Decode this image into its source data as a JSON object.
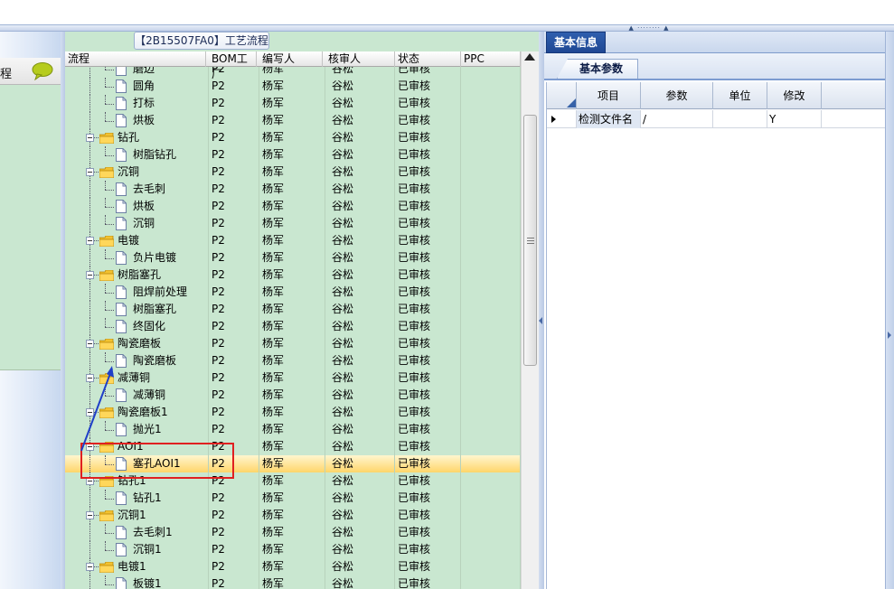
{
  "panel_title": "【2B15507FA0】工艺流程",
  "left_panel": {
    "header_text": "程"
  },
  "columns": [
    "流程",
    "BOM工厂",
    "编写人",
    "核审人",
    "状态",
    "PPC"
  ],
  "rows": [
    {
      "level": 2,
      "type": "file",
      "name": "磨边",
      "bom": "P2",
      "writer": "杨军",
      "reviewer": "谷松",
      "status": "已审核",
      "ppc": ""
    },
    {
      "level": 2,
      "type": "file",
      "name": "圆角",
      "bom": "P2",
      "writer": "杨军",
      "reviewer": "谷松",
      "status": "已审核",
      "ppc": ""
    },
    {
      "level": 2,
      "type": "file",
      "name": "打标",
      "bom": "P2",
      "writer": "杨军",
      "reviewer": "谷松",
      "status": "已审核",
      "ppc": ""
    },
    {
      "level": 2,
      "type": "file",
      "name": "烘板",
      "bom": "P2",
      "writer": "杨军",
      "reviewer": "谷松",
      "status": "已审核",
      "ppc": ""
    },
    {
      "level": 1,
      "type": "folder",
      "name": "钻孔",
      "bom": "P2",
      "writer": "杨军",
      "reviewer": "谷松",
      "status": "已审核",
      "ppc": ""
    },
    {
      "level": 2,
      "type": "file",
      "name": "树脂钻孔",
      "bom": "P2",
      "writer": "杨军",
      "reviewer": "谷松",
      "status": "已审核",
      "ppc": ""
    },
    {
      "level": 1,
      "type": "folder",
      "name": "沉铜",
      "bom": "P2",
      "writer": "杨军",
      "reviewer": "谷松",
      "status": "已审核",
      "ppc": ""
    },
    {
      "level": 2,
      "type": "file",
      "name": "去毛刺",
      "bom": "P2",
      "writer": "杨军",
      "reviewer": "谷松",
      "status": "已审核",
      "ppc": ""
    },
    {
      "level": 2,
      "type": "file",
      "name": "烘板",
      "bom": "P2",
      "writer": "杨军",
      "reviewer": "谷松",
      "status": "已审核",
      "ppc": ""
    },
    {
      "level": 2,
      "type": "file",
      "name": "沉铜",
      "bom": "P2",
      "writer": "杨军",
      "reviewer": "谷松",
      "status": "已审核",
      "ppc": ""
    },
    {
      "level": 1,
      "type": "folder",
      "name": "电镀",
      "bom": "P2",
      "writer": "杨军",
      "reviewer": "谷松",
      "status": "已审核",
      "ppc": ""
    },
    {
      "level": 2,
      "type": "file",
      "name": "负片电镀",
      "bom": "P2",
      "writer": "杨军",
      "reviewer": "谷松",
      "status": "已审核",
      "ppc": ""
    },
    {
      "level": 1,
      "type": "folder",
      "name": "树脂塞孔",
      "bom": "P2",
      "writer": "杨军",
      "reviewer": "谷松",
      "status": "已审核",
      "ppc": ""
    },
    {
      "level": 2,
      "type": "file",
      "name": "阻焊前处理",
      "bom": "P2",
      "writer": "杨军",
      "reviewer": "谷松",
      "status": "已审核",
      "ppc": ""
    },
    {
      "level": 2,
      "type": "file",
      "name": "树脂塞孔",
      "bom": "P2",
      "writer": "杨军",
      "reviewer": "谷松",
      "status": "已审核",
      "ppc": ""
    },
    {
      "level": 2,
      "type": "file",
      "name": "终固化",
      "bom": "P2",
      "writer": "杨军",
      "reviewer": "谷松",
      "status": "已审核",
      "ppc": ""
    },
    {
      "level": 1,
      "type": "folder",
      "name": "陶瓷磨板",
      "bom": "P2",
      "writer": "杨军",
      "reviewer": "谷松",
      "status": "已审核",
      "ppc": ""
    },
    {
      "level": 2,
      "type": "file",
      "name": "陶瓷磨板",
      "bom": "P2",
      "writer": "杨军",
      "reviewer": "谷松",
      "status": "已审核",
      "ppc": ""
    },
    {
      "level": 1,
      "type": "folder",
      "name": "减薄铜",
      "bom": "P2",
      "writer": "杨军",
      "reviewer": "谷松",
      "status": "已审核",
      "ppc": ""
    },
    {
      "level": 2,
      "type": "file",
      "name": "减薄铜",
      "bom": "P2",
      "writer": "杨军",
      "reviewer": "谷松",
      "status": "已审核",
      "ppc": ""
    },
    {
      "level": 1,
      "type": "folder",
      "name": "陶瓷磨板1",
      "bom": "P2",
      "writer": "杨军",
      "reviewer": "谷松",
      "status": "已审核",
      "ppc": ""
    },
    {
      "level": 2,
      "type": "file",
      "name": "抛光1",
      "bom": "P2",
      "writer": "杨军",
      "reviewer": "谷松",
      "status": "已审核",
      "ppc": ""
    },
    {
      "level": 1,
      "type": "folder",
      "name": "AOI1",
      "bom": "P2",
      "writer": "杨军",
      "reviewer": "谷松",
      "status": "已审核",
      "ppc": ""
    },
    {
      "level": 2,
      "type": "file",
      "name": "塞孔AOI1",
      "bom": "P2",
      "writer": "杨军",
      "reviewer": "谷松",
      "status": "已审核",
      "ppc": "",
      "selected": true
    },
    {
      "level": 1,
      "type": "folder",
      "name": "钻孔1",
      "bom": "P2",
      "writer": "杨军",
      "reviewer": "谷松",
      "status": "已审核",
      "ppc": ""
    },
    {
      "level": 2,
      "type": "file",
      "name": "钻孔1",
      "bom": "P2",
      "writer": "杨军",
      "reviewer": "谷松",
      "status": "已审核",
      "ppc": ""
    },
    {
      "level": 1,
      "type": "folder",
      "name": "沉铜1",
      "bom": "P2",
      "writer": "杨军",
      "reviewer": "谷松",
      "status": "已审核",
      "ppc": ""
    },
    {
      "level": 2,
      "type": "file",
      "name": "去毛刺1",
      "bom": "P2",
      "writer": "杨军",
      "reviewer": "谷松",
      "status": "已审核",
      "ppc": ""
    },
    {
      "level": 2,
      "type": "file",
      "name": "沉铜1",
      "bom": "P2",
      "writer": "杨军",
      "reviewer": "谷松",
      "status": "已审核",
      "ppc": ""
    },
    {
      "level": 1,
      "type": "folder",
      "name": "电镀1",
      "bom": "P2",
      "writer": "杨军",
      "reviewer": "谷松",
      "status": "已审核",
      "ppc": ""
    },
    {
      "level": 2,
      "type": "file",
      "name": "板镀1",
      "bom": "P2",
      "writer": "杨军",
      "reviewer": "谷松",
      "status": "已审核",
      "ppc": ""
    }
  ],
  "right_panel": {
    "main_tab": "基本信息",
    "sub_tab": "基本参数",
    "columns": [
      "项目",
      "参数",
      "单位",
      "修改"
    ],
    "rows": [
      {
        "item": "检测文件名",
        "param": "/",
        "unit": "",
        "modify": "Y"
      }
    ]
  },
  "colors": {
    "grid_bg": "#c9e7d0",
    "selection": "#ffd56a",
    "tab_active": "#2f5fae",
    "annotation_box": "#e02020",
    "annotation_arrow": "#1f3fc8"
  }
}
